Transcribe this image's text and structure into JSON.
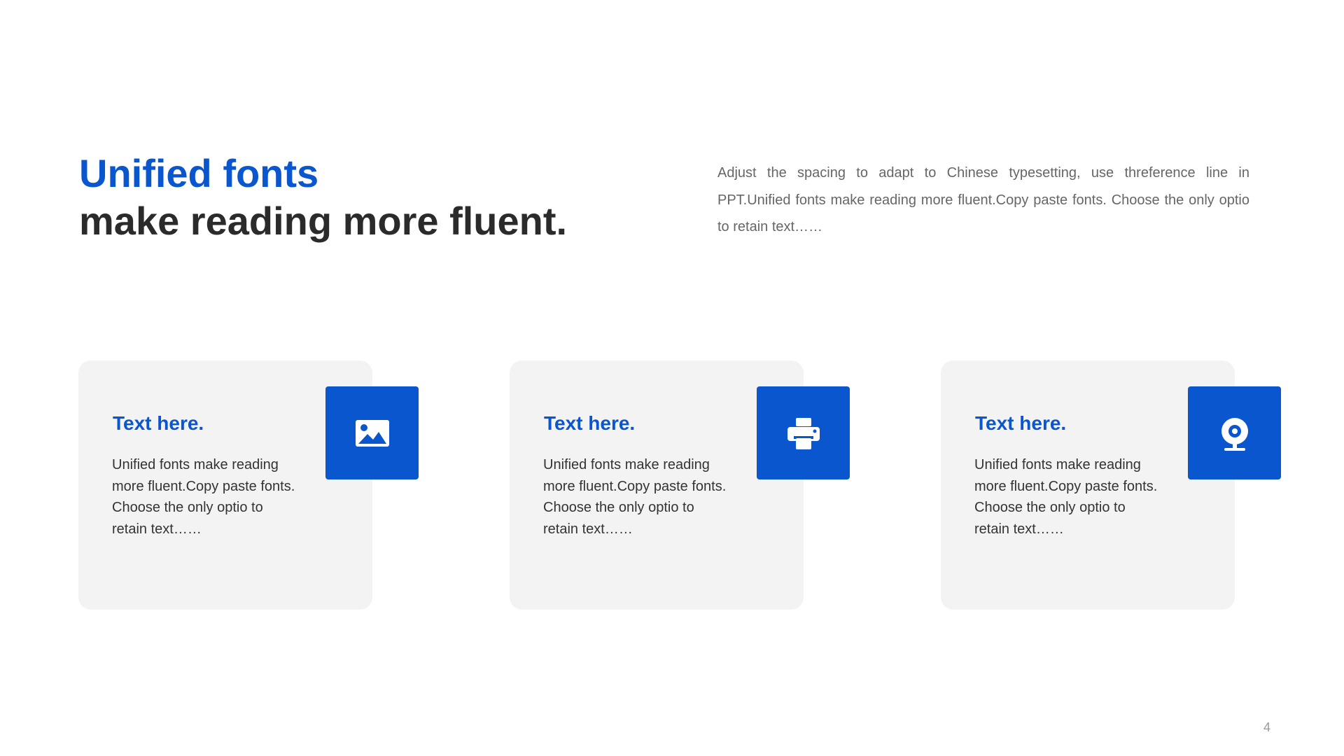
{
  "header": {
    "title_highlight": "Unified fonts",
    "title_main": "make reading more fluent.",
    "intro": "Adjust the spacing to adapt to Chinese typesetting, use threference line in PPT.Unified fonts make reading more fluent.Copy paste fonts. Choose the only optio to retain text……"
  },
  "cards": [
    {
      "title": "Text here.",
      "body": "Unified fonts make reading more fluent.Copy paste fonts. Choose the only optio to retain text……",
      "icon": "image-icon"
    },
    {
      "title": "Text here.",
      "body": "Unified fonts make reading more fluent.Copy paste fonts. Choose the only optio to retain text……",
      "icon": "printer-icon"
    },
    {
      "title": "Text here.",
      "body": "Unified fonts make reading more fluent.Copy paste fonts. Choose the only optio to retain text……",
      "icon": "webcam-icon"
    }
  ],
  "footer": {
    "page_number": "4"
  },
  "colors": {
    "accent": "#0a56cf",
    "heading": "#2b2b2b",
    "body_text": "#333333",
    "muted_text": "#666666",
    "card_background": "#f3f3f3"
  }
}
